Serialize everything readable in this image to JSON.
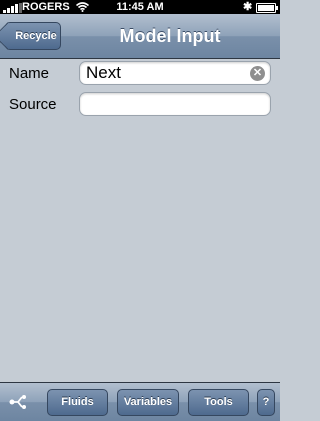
{
  "status_bar": {
    "carrier": "ROGERS",
    "time": "11:45 AM",
    "bluetooth_icon": "bluetooth-icon",
    "battery_icon": "battery-icon"
  },
  "nav_bar": {
    "back_label": "Recycle",
    "title": "Model Input"
  },
  "form": {
    "name": {
      "label": "Name",
      "value": "Next"
    },
    "source": {
      "label": "Source",
      "value": ""
    }
  },
  "toolbar": {
    "tree_icon": "branch-icon",
    "buttons": [
      {
        "label": "Fluids"
      },
      {
        "label": "Variables"
      },
      {
        "label": "Tools"
      },
      {
        "label": "?"
      }
    ]
  },
  "colors": {
    "background": "#c5ccd4",
    "bar": "#6d85a1",
    "button": "#4e6a8e"
  }
}
